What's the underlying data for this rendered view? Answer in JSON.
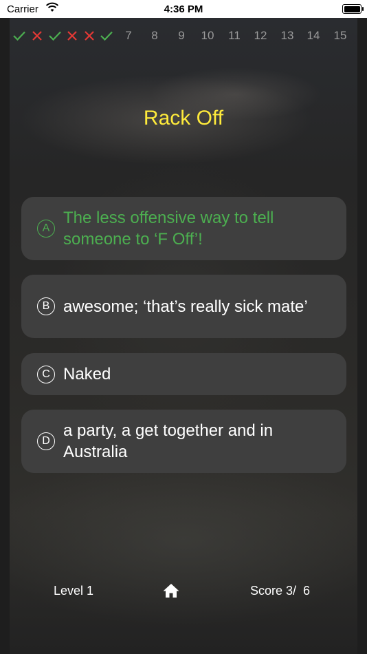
{
  "status_bar": {
    "carrier": "Carrier",
    "time": "4:36 PM"
  },
  "progress": {
    "results": [
      "correct",
      "wrong",
      "correct",
      "wrong",
      "wrong",
      "correct"
    ],
    "numbers": [
      "7",
      "8",
      "9",
      "10",
      "11",
      "12",
      "13",
      "14",
      "15"
    ],
    "correct_color": "#4caf50",
    "wrong_color": "#e53935"
  },
  "question": {
    "title": "Rack Off"
  },
  "answers": [
    {
      "letter": "A",
      "text": " The less offensive way to tell someone to ‘F Off’!",
      "state": "correct"
    },
    {
      "letter": "B",
      "text": " awesome; ‘that’s really sick mate’",
      "state": "normal"
    },
    {
      "letter": "C",
      "text": " Naked",
      "state": "normal"
    },
    {
      "letter": "D",
      "text": " a party, a get together and in Australia",
      "state": "normal"
    }
  ],
  "footer": {
    "level": "Level 1",
    "score": "Score 3/  6",
    "home_icon": "home-icon"
  },
  "colors": {
    "title": "#ffeb3b",
    "answer_bg": "#3f3f3f"
  }
}
